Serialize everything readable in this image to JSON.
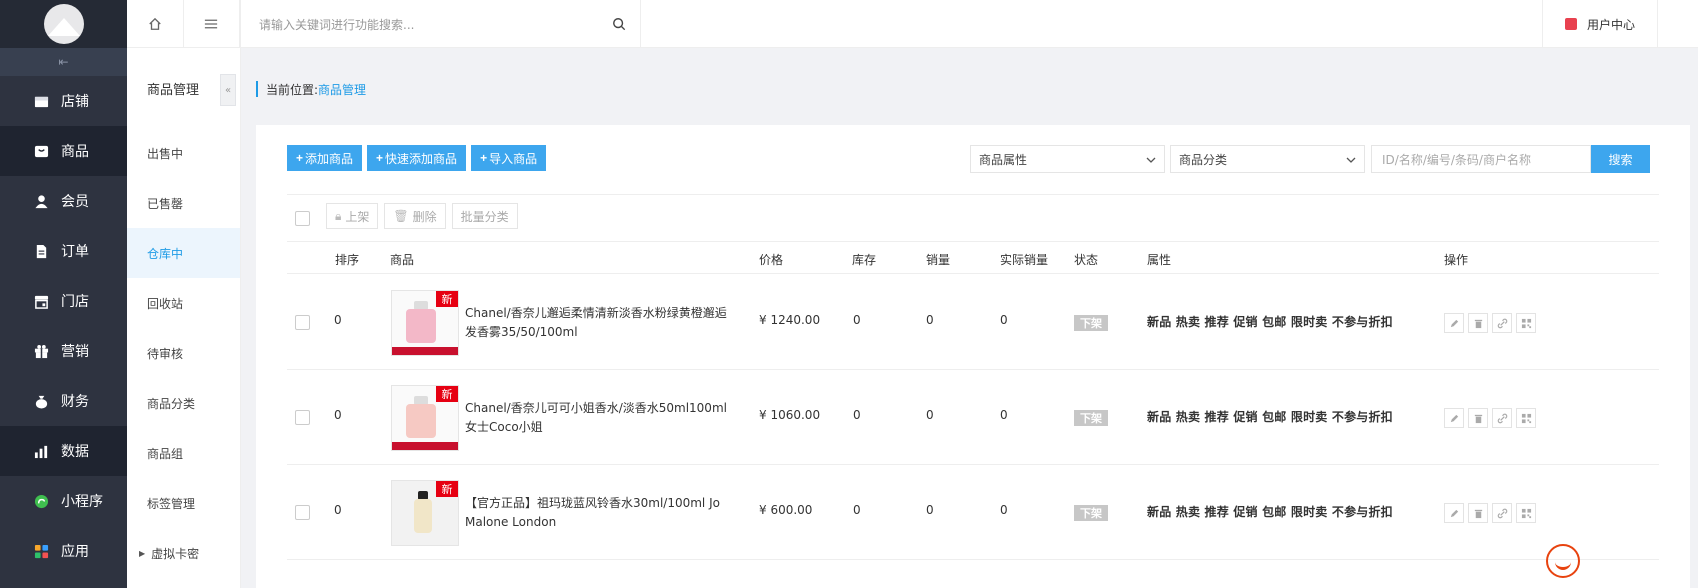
{
  "sidebar": {
    "collapse_glyph": "⇤",
    "items": [
      {
        "label": "店铺",
        "icon": "store-icon"
      },
      {
        "label": "商品",
        "icon": "product-icon",
        "active": true
      },
      {
        "label": "会员",
        "icon": "member-icon"
      },
      {
        "label": "订单",
        "icon": "order-icon"
      },
      {
        "label": "门店",
        "icon": "shop-icon"
      },
      {
        "label": "营销",
        "icon": "gift-icon"
      },
      {
        "label": "财务",
        "icon": "money-bag-icon"
      },
      {
        "label": "数据",
        "icon": "chart-icon",
        "active_dark": true
      },
      {
        "label": "小程序",
        "icon": "mini-program-icon"
      },
      {
        "label": "应用",
        "icon": "apps-icon"
      }
    ]
  },
  "subnav": {
    "title": "商品管理",
    "fold_glyph": "«",
    "items": [
      {
        "label": "出售中"
      },
      {
        "label": "已售罄"
      },
      {
        "label": "仓库中",
        "active": true
      },
      {
        "label": "回收站"
      },
      {
        "label": "待审核"
      },
      {
        "label": "商品分类"
      },
      {
        "label": "商品组"
      },
      {
        "label": "标签管理"
      },
      {
        "label": "虚拟卡密",
        "caret": "▶"
      }
    ]
  },
  "topbar": {
    "search_placeholder": "请输入关键词进行功能搜索...",
    "user_center": "用户中心"
  },
  "breadcrumb": {
    "prefix": "当前位置:",
    "current": "商品管理"
  },
  "toolbar": {
    "add": "添加商品",
    "quick_add": "快速添加商品",
    "import": "导入商品",
    "filter_attr": "商品属性",
    "filter_category": "商品分类",
    "keyword_placeholder": "ID/名称/编号/条码/商户名称",
    "search": "搜索"
  },
  "bulk": {
    "shelve": "上架",
    "delete": "删除",
    "batch_category": "批量分类"
  },
  "table": {
    "headers": {
      "sort": "排序",
      "product": "商品",
      "price": "价格",
      "stock": "库存",
      "sales": "销量",
      "actual_sales": "实际销量",
      "status": "状态",
      "attrs": "属性",
      "ops": "操作"
    },
    "rows": [
      {
        "sort": "0",
        "name": "Chanel/香奈儿邂逅柔情清新淡香水粉绿黄橙邂逅发香雾35/50/100ml",
        "price": "¥ 1240.00",
        "stock": "0",
        "sales": "0",
        "actual_sales": "0",
        "status": "下架",
        "attrs": "新品 热卖 推荐 促销 包邮 限时卖 不参与折扣",
        "badge": "新",
        "bottle_color": "#f3b8c8"
      },
      {
        "sort": "0",
        "name": "Chanel/香奈儿可可小姐香水/淡香水50ml100ml女士Coco小姐",
        "price": "¥ 1060.00",
        "stock": "0",
        "sales": "0",
        "actual_sales": "0",
        "status": "下架",
        "attrs": "新品 热卖 推荐 促销 包邮 限时卖 不参与折扣",
        "badge": "新",
        "bottle_color": "#f6c9c3"
      },
      {
        "sort": "0",
        "name": "【官方正品】祖玛珑蓝风铃香水30ml/100ml Jo Malone London",
        "price": "¥ 600.00",
        "stock": "0",
        "sales": "0",
        "actual_sales": "0",
        "status": "下架",
        "attrs": "新品 热卖 推荐 促销 包邮 限时卖 不参与折扣",
        "badge": "新",
        "bottle_color": "#f1e6c8"
      }
    ]
  },
  "colors": {
    "sidebar_bg": "#2e3340",
    "accent": "#3da6ee",
    "stock_red": "#e53a21",
    "badge_red": "#e60012"
  }
}
